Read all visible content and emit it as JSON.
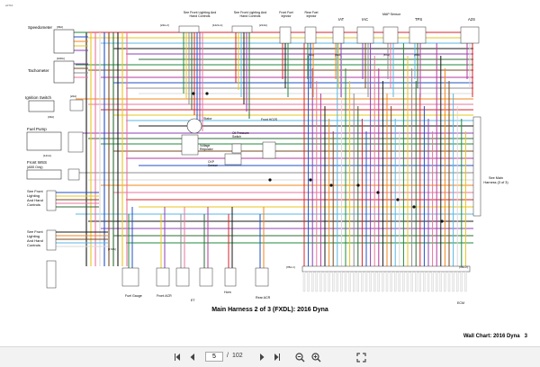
{
  "page": {
    "id": "e0710",
    "title": "Main Harness 2 of 3 (FXDL): 2016 Dyna",
    "wall_chart_label": "Wall Chart:",
    "wall_chart_value": "2016 Dyna",
    "wall_chart_number": "3"
  },
  "diagram": {
    "components": {
      "speedometer": "Speedometer",
      "tachometer": "Tachometer",
      "ignition_switch": "Ignition Switch",
      "fuel_pump": "Fuel Pump",
      "front_wss": "Front WSS",
      "front_wss_sub": "(ABS Only)",
      "front_lighting_left": "See Front Lighting And Hand Controls",
      "front_lighting_right": "See Front Lighting And Hand Controls",
      "front_fuel_injector": "Front Fuel Injector",
      "rear_fuel_injector": "Rear Fuel Injector",
      "iat": "IAT",
      "iac": "IAC",
      "map_sensor": "MAP Sensor",
      "tps": "TPS",
      "a2s": "A2S",
      "regulator": "Voltage Regulator",
      "stator": "Stator",
      "oil_pressure": "Oil Pressure Switch",
      "ckp_sensor": "CKP Sensor",
      "front_hoe2s": "Front HO2S",
      "see_main_harness": "See Main Harness (3 of 3)",
      "side_front_lighting_1": "See Front Lighting And Hand Controls",
      "side_front_lighting_2": "See Front Lighting And Hand Controls",
      "fuel_gauge": "Fuel Gauge",
      "front_acr": "Front ACR",
      "rear_acr": "Rear ACR",
      "et": "ET",
      "horn": "Horn",
      "ecm": "ECM"
    },
    "connectors": [
      "[39A]",
      "[39B]",
      "[108A]",
      "[108B]",
      "[22A]",
      "[22B]",
      "[33A]",
      "[33B]",
      "[141A]",
      "[141B]",
      "[24A-2]",
      "[24B-2]",
      "[122A-1]",
      "[122B-1]",
      "[214A]",
      "[214B]",
      "[91A]",
      "[91B]",
      "[84A]",
      "[84B]",
      "[87A]",
      "[87B]",
      "[65A]",
      "[65B]",
      "[78A-1]",
      "[78B-1]",
      "[78A-2]",
      "[78B-2]",
      "[172A]",
      "[172B]",
      "[46A]",
      "[46B]",
      "[130A]",
      "[130B]",
      "[179A]",
      "[179B]",
      "[77A]",
      "[77B]",
      "[47A]",
      "[47B]",
      "[120A]",
      "[120B]",
      "[135B]"
    ]
  },
  "colors": {
    "red": "#d8232a",
    "black": "#1a1a1a",
    "green": "#1f8a3b",
    "blue": "#2150c4",
    "orange": "#f0861c",
    "yellow": "#e7c51d",
    "purple": "#8c3fb5",
    "brown": "#7a4a23",
    "gray": "#8c8c8c",
    "pink": "#e8759c",
    "lightblue": "#58b7e3",
    "white": "#d9d9d9",
    "darkgreen": "#2e6b35",
    "violet": "#b23a9d"
  },
  "viewer": {
    "first_page_icon": "first-page-icon",
    "prev_page_icon": "prev-page-icon",
    "current_page": "5",
    "separator": "/",
    "total_pages": "102",
    "next_page_icon": "next-page-icon",
    "last_page_icon": "last-page-icon",
    "zoom_out_icon": "zoom-out-icon",
    "zoom_in_icon": "zoom-in-icon",
    "fullscreen_icon": "fullscreen-icon"
  }
}
